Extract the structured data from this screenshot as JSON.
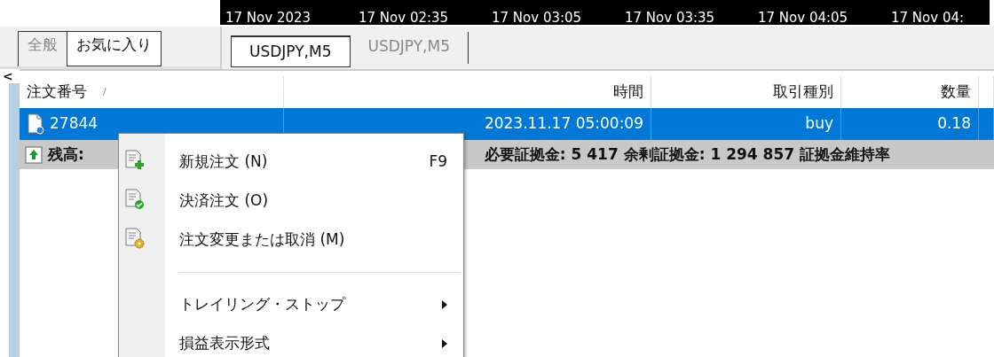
{
  "time_axis": [
    "17 Nov 2023",
    "17 Nov 02:35",
    "17 Nov 03:05",
    "17 Nov 03:35",
    "17 Nov 04:05",
    "17 Nov 04:"
  ],
  "navigator_tabs": [
    {
      "label": "全般",
      "selected": false
    },
    {
      "label": "お気に入り",
      "selected": true
    }
  ],
  "chart_tabs": [
    {
      "label": "USDJPY,M5",
      "selected": true
    },
    {
      "label": "USDJPY,M5",
      "selected": false
    }
  ],
  "collapse_arrow": "<",
  "table": {
    "columns": [
      {
        "label": "注文番号",
        "sort": "/"
      },
      {
        "label": "時間"
      },
      {
        "label": "取引種別"
      },
      {
        "label": "数量"
      }
    ],
    "rows": [
      {
        "selected": true,
        "cells": [
          "27844",
          "2023.11.17 05:00:09",
          "buy",
          "0.18"
        ]
      }
    ],
    "summary": {
      "label": "残高:",
      "text": "必要証拠金: 5 417  余剰証拠金: 1 294 857  証拠金維持率"
    }
  },
  "context_menu": {
    "items": [
      {
        "kind": "item",
        "label": "新規注文 (N)",
        "shortcut": "F9"
      },
      {
        "kind": "item",
        "label": "決済注文 (O)"
      },
      {
        "kind": "item",
        "label": "注文変更または取消 (M)"
      },
      {
        "kind": "separator"
      },
      {
        "kind": "submenu",
        "label": "トレイリング・ストップ"
      },
      {
        "kind": "submenu",
        "label": "損益表示形式"
      }
    ]
  }
}
